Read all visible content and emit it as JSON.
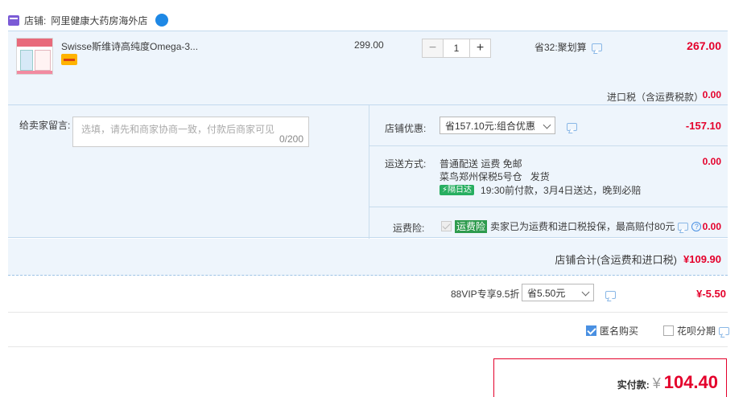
{
  "shop": {
    "label": "店铺:",
    "name": "阿里健康大药房海外店"
  },
  "item": {
    "title": "Swisse斯维诗高纯度Omega-3...",
    "price": "299.00",
    "quantity": "1",
    "minus": "−",
    "plus": "+",
    "discount_label": "省32:聚划算",
    "subtotal": "267.00",
    "tax_label": "进口税（含运费税款）",
    "tax_value": "0.00"
  },
  "memo": {
    "label": "给卖家留言:",
    "placeholder": "选填，请先和商家协商一致，付款后商家可见",
    "counter": "0/200"
  },
  "coupon": {
    "label": "店铺优惠:",
    "selected": "省157.10元:组合优惠",
    "value": "-157.10"
  },
  "shipping": {
    "label": "运送方式:",
    "method": "普通配送 运费 免邮",
    "warehouse": "菜鸟郑州保税5号仓",
    "ship_type": "发货",
    "tag": "隔日达",
    "promise": "19:30前付款，3月4日送达，晚到必赔",
    "value": "0.00"
  },
  "insurance": {
    "label": "运费险:",
    "tag": "运费险",
    "text": "卖家已为运费和进口税投保，最高赔付80元",
    "value": "0.00"
  },
  "store_total": {
    "label": "店铺合计(含运费和进口税)",
    "value": "¥109.90"
  },
  "vip": {
    "label": "88VIP专享9.5折",
    "selected": "省5.50元",
    "value": "¥-5.50"
  },
  "options": {
    "anonymous": "匿名购买",
    "huabei": "花呗分期"
  },
  "pay": {
    "label": "实付款:",
    "currency": "¥",
    "amount": "104.40"
  },
  "colors": {
    "accent_red": "#e4002b",
    "panel_bg": "#eef5fc",
    "border_blue": "#c2d9ee"
  },
  "icons": [
    "shop-icon",
    "wangwang-icon",
    "chat-icon",
    "chevron-down-icon",
    "lightning-icon",
    "question-icon",
    "checkbox-icon"
  ]
}
